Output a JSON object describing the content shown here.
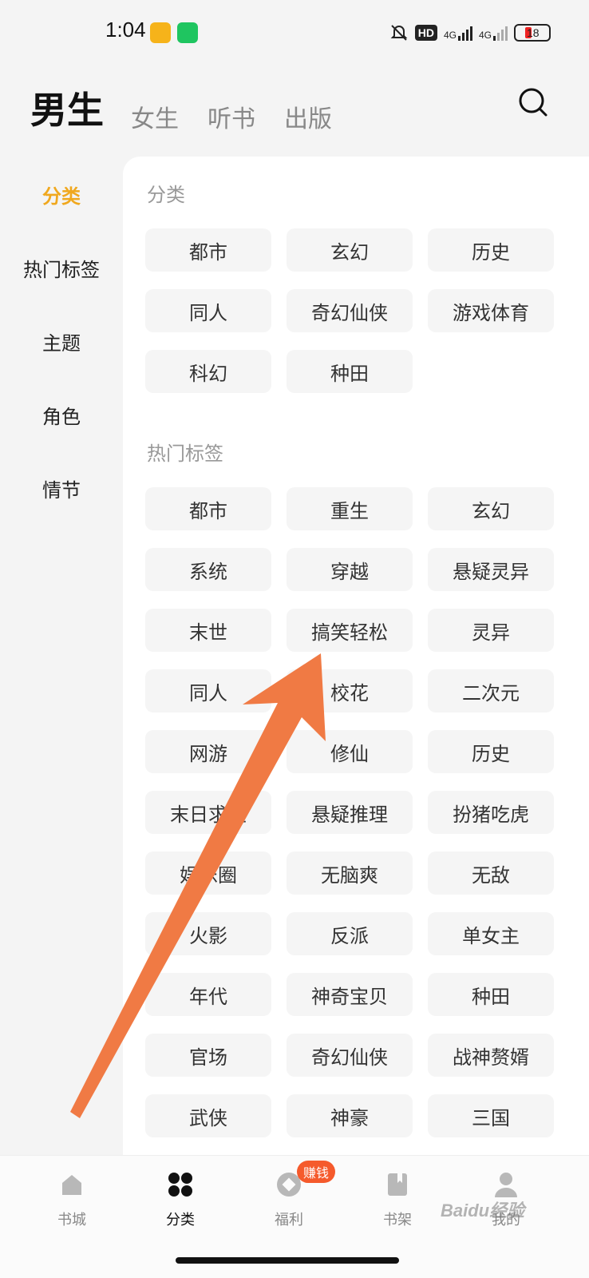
{
  "status": {
    "time": "1:04",
    "hd": "HD",
    "net1": "4G",
    "net2": "4G",
    "battery": "18"
  },
  "nav": {
    "tabs": [
      "男生",
      "女生",
      "听书",
      "出版"
    ],
    "active": "男生"
  },
  "sidebar": {
    "items": [
      "分类",
      "热门标签",
      "主题",
      "角色",
      "情节"
    ],
    "active": "分类"
  },
  "sections": {
    "category": {
      "title": "分类",
      "chips": [
        "都市",
        "玄幻",
        "历史",
        "同人",
        "奇幻仙侠",
        "游戏体育",
        "科幻",
        "种田"
      ]
    },
    "hot_tags": {
      "title": "热门标签",
      "chips": [
        "都市",
        "重生",
        "玄幻",
        "系统",
        "穿越",
        "悬疑灵异",
        "末世",
        "搞笑轻松",
        "灵异",
        "同人",
        "校花",
        "二次元",
        "网游",
        "修仙",
        "历史",
        "末日求生",
        "悬疑推理",
        "扮猪吃虎",
        "娱乐圈",
        "无脑爽",
        "无敌",
        "火影",
        "反派",
        "单女主",
        "年代",
        "神奇宝贝",
        "种田",
        "官场",
        "奇幻仙侠",
        "战神赘婿",
        "武侠",
        "神豪",
        "三国"
      ]
    }
  },
  "tabbar": {
    "items": [
      "书城",
      "分类",
      "福利",
      "书架",
      "我的"
    ],
    "active": "分类",
    "earn_badge": "赚钱"
  },
  "colors": {
    "accent": "#f0a81e",
    "arrow": "#f07a44",
    "badge": "#f55a2c"
  },
  "watermark": "Baidu经验"
}
